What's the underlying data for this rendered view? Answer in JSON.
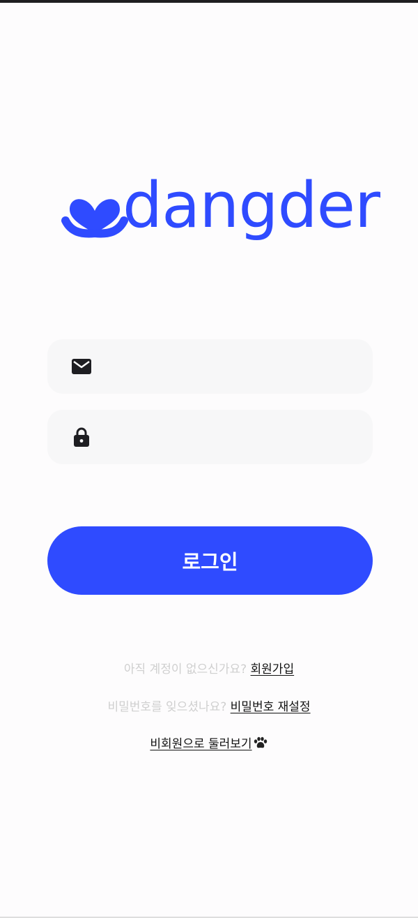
{
  "brand": {
    "name": "dangder",
    "color": "#2f4bff"
  },
  "form": {
    "email_field": {
      "value": "",
      "icon": "mail-icon"
    },
    "password_field": {
      "value": "",
      "icon": "lock-icon"
    }
  },
  "login_button": {
    "label": "로그인",
    "color": "#2f4bff"
  },
  "links": {
    "signup_prompt": "아직 계정이 없으신가요?",
    "signup_link": "회원가입",
    "reset_prompt": "비밀번호를 잊으셨나요?",
    "reset_link": "비밀번호 재설정",
    "guest_link": "비회원으로 둘러보기",
    "guest_icon": "paw-icon"
  },
  "colors": {
    "muted_text": "#cfcfcf",
    "field_bg": "#f7f7f8"
  }
}
